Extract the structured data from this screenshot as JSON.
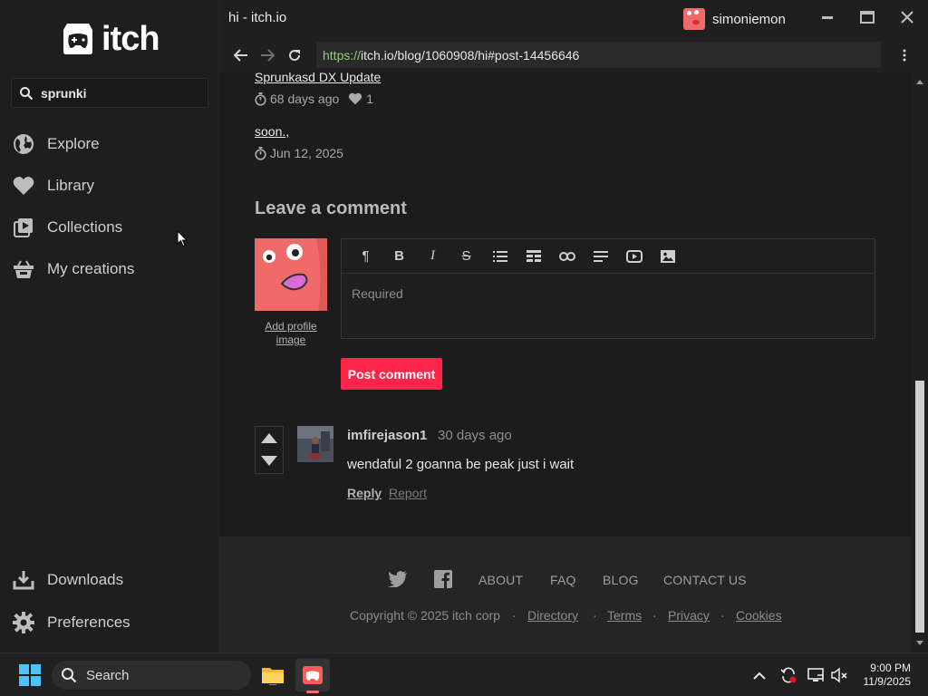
{
  "window": {
    "title": "hi - itch.io",
    "user_name": "simoniemon"
  },
  "sidebar": {
    "logo_text": "itch",
    "search_value": "sprunki",
    "items": [
      {
        "label": "Explore",
        "icon": "globe-icon"
      },
      {
        "label": "Library",
        "icon": "heart-icon"
      },
      {
        "label": "Collections",
        "icon": "collections-icon"
      },
      {
        "label": "My creations",
        "icon": "basket-icon"
      }
    ],
    "bottom_items": [
      {
        "label": "Downloads",
        "icon": "download-icon"
      },
      {
        "label": "Preferences",
        "icon": "gear-icon"
      }
    ]
  },
  "address": {
    "protocol": "https://",
    "rest": "itch.io/blog/1060908/hi#post-14456646"
  },
  "posts": [
    {
      "title": "Sprunkasd DX Update",
      "time": "68 days ago",
      "likes": "1"
    },
    {
      "title": "soon.,",
      "time": "Jun 12, 2025"
    }
  ],
  "comment_form": {
    "heading": "Leave a comment",
    "add_profile_image": "Add profile image",
    "placeholder": "Required",
    "post_button": "Post comment"
  },
  "comment": {
    "author": "imfirejason1",
    "time": "30 days ago",
    "text": "wendaful 2 goanna be peak just i wait",
    "reply": "Reply",
    "report": "Report"
  },
  "footer": {
    "links": [
      "ABOUT",
      "FAQ",
      "BLOG",
      "CONTACT US"
    ],
    "copyright": "Copyright © 2025 itch corp",
    "legal": [
      "Directory",
      "Terms",
      "Privacy",
      "Cookies"
    ],
    "separator": "·"
  },
  "taskbar": {
    "search_label": "Search",
    "time": "9:00 PM",
    "date": "11/9/2025"
  },
  "colors": {
    "accent": "#ff2449",
    "url_protocol": "#8ccf77"
  }
}
